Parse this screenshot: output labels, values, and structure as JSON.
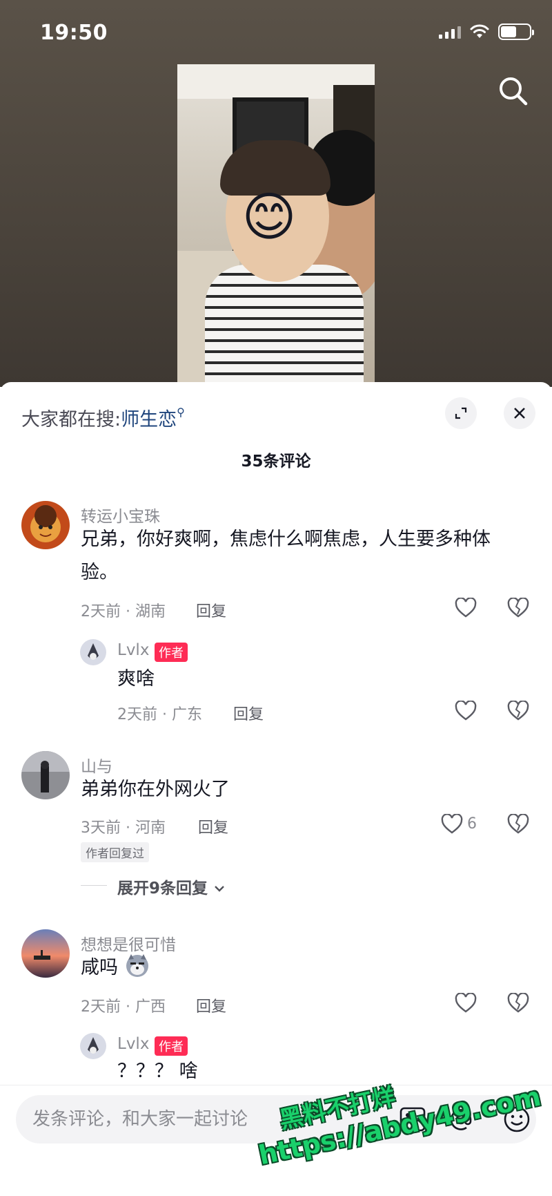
{
  "status_bar": {
    "time": "19:50"
  },
  "video": {
    "emoji_sticker": "😊"
  },
  "sheet": {
    "hot_search_prefix": "大家都在搜:",
    "hot_search_keyword": "师生恋",
    "comment_count": "35条评论"
  },
  "comments": [
    {
      "username": "转运小宝珠",
      "text_line1": "兄弟，你好爽啊，焦虑什么啊焦虑，人生要多种体",
      "text_line2": "验。",
      "meta": "2天前 · 湖南",
      "reply": "回复",
      "replies": [
        {
          "username": "Lvlx",
          "badge": "作者",
          "text": "爽啥",
          "meta": "2天前 · 广东",
          "reply": "回复"
        }
      ]
    },
    {
      "username": "山与",
      "text": "弟弟你在外网火了",
      "meta": "3天前 · 河南",
      "reply": "回复",
      "likes": "6",
      "author_replied": "作者回复过",
      "expand_label": "展开9条回复"
    },
    {
      "username": "想想是很可惜",
      "text": "咸吗",
      "meta": "2天前 · 广西",
      "reply": "回复",
      "replies": [
        {
          "username": "Lvlx",
          "badge": "作者",
          "text": "？？？ 啥"
        }
      ]
    }
  ],
  "input_bar": {
    "placeholder": "发条评论，和大家一起讨论"
  },
  "watermark": {
    "line1": "黑料不打烊",
    "line2": "https://abdy49.com"
  },
  "icons": [
    "search-icon",
    "expand-icon",
    "close-icon",
    "heart-icon",
    "dislike-heart-icon",
    "chevron-down-icon",
    "image-icon",
    "at-icon",
    "emoji-icon"
  ]
}
